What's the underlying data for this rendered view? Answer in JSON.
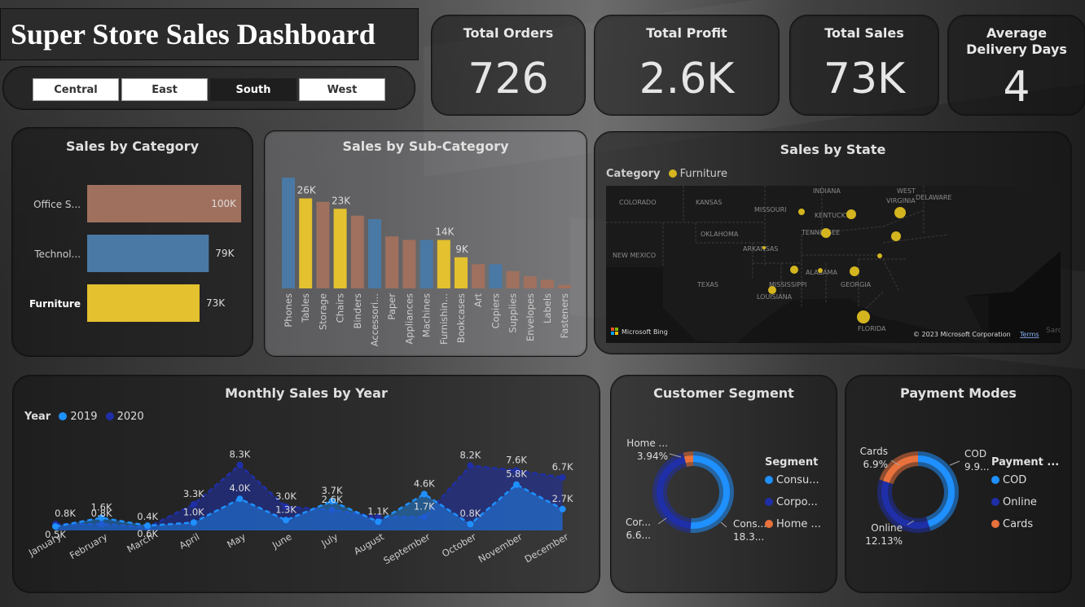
{
  "title": "Super Store Sales Dashboard",
  "regions": [
    {
      "label": "Central",
      "selected": false
    },
    {
      "label": "East",
      "selected": false
    },
    {
      "label": "South",
      "selected": true
    },
    {
      "label": "West",
      "selected": false
    }
  ],
  "kpis": {
    "orders": {
      "label": "Total Orders",
      "value": "726"
    },
    "profit": {
      "label": "Total Profit",
      "value": "2.6K"
    },
    "sales": {
      "label": "Total Sales",
      "value": "73K"
    },
    "delivery": {
      "label": "Average Delivery Days",
      "value": "4"
    }
  },
  "colors": {
    "brown": "#a0705e",
    "blue": "#4a79a5",
    "yellow": "#e3c12f",
    "y2019": "#1e90ff",
    "y2020": "#1f2fa8",
    "orange": "#e8713c"
  },
  "map": {
    "title": "Sales by State",
    "legend_label": "Category",
    "legend_item": "Furniture",
    "states": [
      "COLORADO",
      "KANSAS",
      "MISSOURI",
      "INDIANA",
      "WEST",
      "VIRGINIA",
      "DELAWARE",
      "OKLAHOMA",
      "TENNESSEE",
      "KENTUCKY",
      "ARKANSAS",
      "NEW MEXICO",
      "TEXAS",
      "MISSISSIPPI",
      "ALABAMA",
      "GEORGIA",
      "LOUISIANA",
      "FLORIDA"
    ],
    "bing_label": "Microsoft Bing",
    "copyright": "© 2023 Microsoft Corporation",
    "terms": "Terms",
    "edge_label": "Sarc"
  },
  "chart_data": [
    {
      "id": "category",
      "type": "bar",
      "orientation": "horizontal",
      "title": "Sales by Category",
      "categories": [
        "Office S...",
        "Technol...",
        "Furniture"
      ],
      "values": [
        100,
        79,
        73
      ],
      "labels": [
        "100K",
        "79K",
        "73K"
      ],
      "colors": [
        "#a0705e",
        "#4a79a5",
        "#e3c12f"
      ],
      "highlighted": "Furniture"
    },
    {
      "id": "subcategory",
      "type": "bar",
      "title": "Sales by Sub-Category",
      "categories": [
        "Phones",
        "Tables",
        "Storage",
        "Chairs",
        "Binders",
        "Accessori...",
        "Paper",
        "Appliances",
        "Machines",
        "Furnishin...",
        "Bookcases",
        "Art",
        "Copiers",
        "Supplies",
        "Envelopes",
        "Labels",
        "Fasteners"
      ],
      "values": [
        32,
        26,
        25,
        23,
        21,
        20,
        15,
        14,
        14,
        14,
        9,
        7,
        7,
        5,
        3.5,
        2.5,
        1
      ],
      "data_labels": {
        "Tables": "26K",
        "Chairs": "23K",
        "Furnishin...": "14K",
        "Bookcases": "9K"
      },
      "colors": [
        "#4a79a5",
        "#e3c12f",
        "#a0705e",
        "#e3c12f",
        "#a0705e",
        "#4a79a5",
        "#a0705e",
        "#a0705e",
        "#4a79a5",
        "#e3c12f",
        "#e3c12f",
        "#a0705e",
        "#4a79a5",
        "#a0705e",
        "#a0705e",
        "#a0705e",
        "#a0705e"
      ]
    },
    {
      "id": "monthly",
      "type": "area",
      "title": "Monthly Sales by Year",
      "legend_title": "Year",
      "categories": [
        "January",
        "February",
        "March",
        "April",
        "May",
        "June",
        "July",
        "August",
        "September",
        "October",
        "November",
        "December"
      ],
      "series": [
        {
          "name": "2019",
          "color": "#1e90ff",
          "values": [
            0.5,
            1.6,
            0.6,
            1.0,
            4.0,
            1.3,
            3.7,
            1.1,
            4.6,
            0.8,
            5.8,
            2.7
          ],
          "labels": [
            "0.5K",
            "1.6K",
            "0.6K",
            "1.0K",
            "4.0K",
            "1.3K",
            "3.7K",
            "1.1K",
            "4.6K",
            "0.8K",
            "5.8K",
            "2.7K"
          ]
        },
        {
          "name": "2020",
          "color": "#1f2fa8",
          "values": [
            0.8,
            0.8,
            0.4,
            3.3,
            8.3,
            3.0,
            2.6,
            1.7,
            1.7,
            8.2,
            7.6,
            6.7
          ],
          "labels": [
            "0.8K",
            "0.8K",
            "0.4K",
            "3.3K",
            "8.3K",
            "3.0K",
            "2.6K",
            "",
            "1.7K",
            "8.2K",
            "7.6K",
            "6.7K"
          ]
        }
      ],
      "ylim": [
        0,
        10
      ]
    },
    {
      "id": "segment",
      "type": "pie",
      "title": "Customer Segment",
      "legend_title": "Segment",
      "slices": [
        {
          "name": "Consu...",
          "label_name": "Cons...",
          "label_value": "18.3...",
          "value": 51.1,
          "color": "#1e90ff"
        },
        {
          "name": "Corpo...",
          "label_name": "Cor...",
          "label_value": "6.6...",
          "value": 44.9,
          "color": "#1f2fa8"
        },
        {
          "name": "Home ...",
          "label_name": "Home ...",
          "label_value": "3.94%",
          "value": 3.94,
          "color": "#e8713c"
        }
      ]
    },
    {
      "id": "payment",
      "type": "pie",
      "title": "Payment Modes",
      "legend_title": "Payment ...",
      "slices": [
        {
          "name": "COD",
          "label_name": "COD",
          "label_value": "9.9...",
          "value": 45,
          "color": "#1e90ff"
        },
        {
          "name": "Online",
          "label_name": "Online",
          "label_value": "12.13%",
          "value": 35,
          "color": "#1f2fa8"
        },
        {
          "name": "Cards",
          "label_name": "Cards",
          "label_value": "6.9%",
          "value": 20,
          "color": "#e8713c"
        }
      ]
    }
  ]
}
